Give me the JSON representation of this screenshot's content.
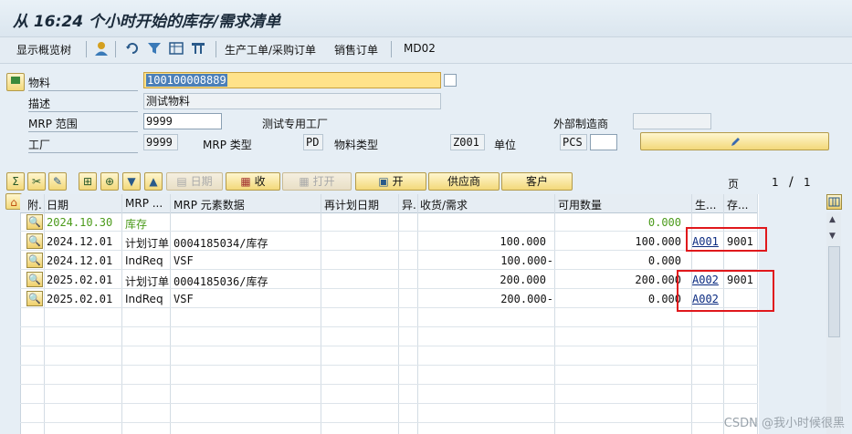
{
  "window": {
    "title": "从 16:24 个小时开始的库存/需求清单"
  },
  "toolbar": {
    "show_tree": "显示概览树",
    "prod_purchase": "生产工单/采购订单",
    "sales_order": "销售订单",
    "md02": "MD02",
    "icons": [
      "person-icon",
      "refresh-icon",
      "filter-icon",
      "grid-icon",
      "transfer-icon"
    ]
  },
  "header": {
    "material_label": "物料",
    "material_value": "100100008889",
    "desc_label": "描述",
    "desc_value": "测试物料",
    "mrp_area_label": "MRP 范围",
    "mrp_area_value": "9999",
    "plant_desc": "测试专用工厂",
    "ext_vendor_label": "外部制造商",
    "ext_vendor_value": "",
    "plant_label": "工厂",
    "plant_value": "9999",
    "mrp_type_label": "MRP 类型",
    "mrp_type_value": "PD",
    "mat_type_label": "物料类型",
    "mat_type_value": "Z001",
    "unit_label": "单位",
    "unit_value": "PCS"
  },
  "grid_toolbar": {
    "date_btn": "日期",
    "receive_btn": "收",
    "open_btn": "打开",
    "open2_btn": "开",
    "vendor_btn": "供应商",
    "customer_btn": "客户",
    "page_label": "页",
    "page_current": "1",
    "page_sep": "/",
    "page_total": "1"
  },
  "columns": [
    "附.",
    "日期",
    "MRP ...",
    "MRP 元素数据",
    "再计划日期",
    "异.",
    "收货/需求",
    "可用数量",
    "生...",
    "存..."
  ],
  "rows": [
    {
      "date": "2024.10.30",
      "elem": "库存",
      "data": "",
      "qty": "",
      "avail": "0.000",
      "c1": "",
      "c2": ""
    },
    {
      "date": "2024.12.01",
      "elem": "计划订单",
      "data": "0004185034/库存",
      "qty": "100.000",
      "avail": "100.000",
      "c1": "A001",
      "c2": "9001"
    },
    {
      "date": "2024.12.01",
      "elem": "IndReq",
      "data": "VSF",
      "qty": "100.000-",
      "avail": "0.000",
      "c1": "",
      "c2": ""
    },
    {
      "date": "2025.02.01",
      "elem": "计划订单",
      "data": "0004185036/库存",
      "qty": "200.000",
      "avail": "200.000",
      "c1": "A002",
      "c2": "9001"
    },
    {
      "date": "2025.02.01",
      "elem": "IndReq",
      "data": "VSF",
      "qty": "200.000-",
      "avail": "0.000",
      "c1": "A002",
      "c2": ""
    }
  ],
  "watermark": "CSDN @我小时候很黑"
}
